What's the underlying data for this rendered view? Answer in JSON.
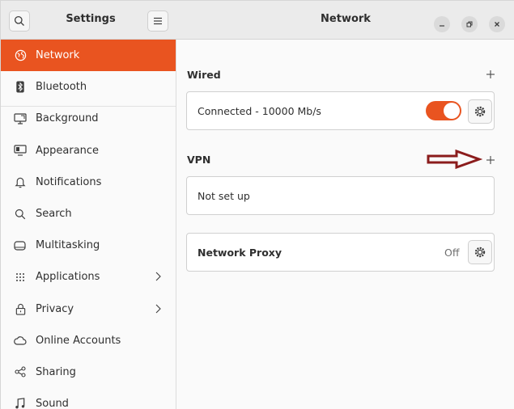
{
  "sidebar": {
    "title": "Settings",
    "items": [
      {
        "label": "Network",
        "icon": "network-icon",
        "active": true
      },
      {
        "label": "Bluetooth",
        "icon": "bluetooth-icon"
      },
      {
        "label": "Background",
        "icon": "background-icon"
      },
      {
        "label": "Appearance",
        "icon": "appearance-icon"
      },
      {
        "label": "Notifications",
        "icon": "bell-icon"
      },
      {
        "label": "Search",
        "icon": "search-icon"
      },
      {
        "label": "Multitasking",
        "icon": "multitasking-icon"
      },
      {
        "label": "Applications",
        "icon": "apps-grid-icon",
        "submenu": true
      },
      {
        "label": "Privacy",
        "icon": "lock-icon",
        "submenu": true
      },
      {
        "label": "Online Accounts",
        "icon": "cloud-icon"
      },
      {
        "label": "Sharing",
        "icon": "share-icon"
      },
      {
        "label": "Sound",
        "icon": "music-note-icon"
      }
    ]
  },
  "header": {
    "title": "Network"
  },
  "wired": {
    "label": "Wired",
    "status": "Connected - 10000 Mb/s",
    "enabled": true
  },
  "vpn": {
    "label": "VPN",
    "status": "Not set up"
  },
  "proxy": {
    "label": "Network Proxy",
    "state": "Off"
  },
  "colors": {
    "accent": "#e95420",
    "annotation_arrow": "#8b1c1c"
  }
}
